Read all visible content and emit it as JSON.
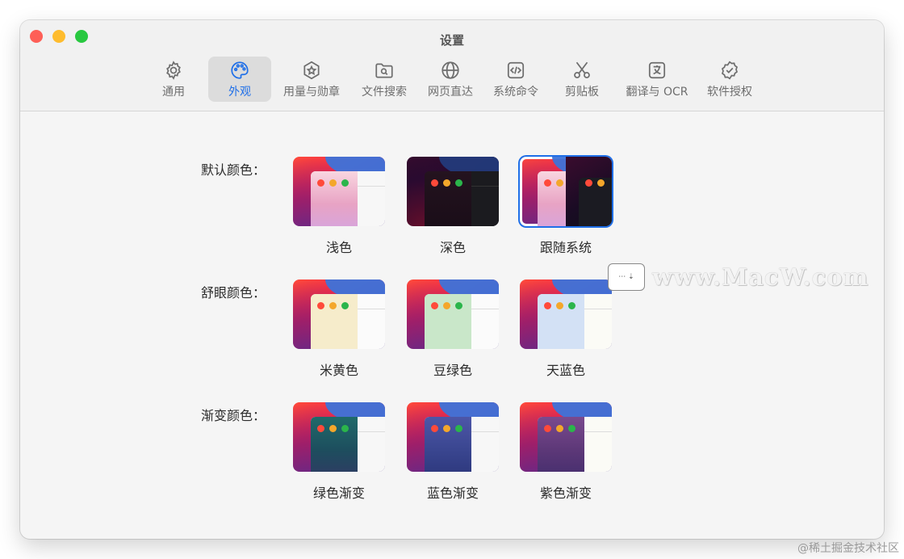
{
  "window": {
    "title": "设置"
  },
  "tabs": [
    {
      "label": "通用",
      "icon": "gear-icon"
    },
    {
      "label": "外观",
      "icon": "palette-icon",
      "active": true
    },
    {
      "label": "用量与勋章",
      "icon": "star-badge-icon"
    },
    {
      "label": "文件搜索",
      "icon": "folder-search-icon"
    },
    {
      "label": "网页直达",
      "icon": "globe-icon"
    },
    {
      "label": "系统命令",
      "icon": "code-icon"
    },
    {
      "label": "剪贴板",
      "icon": "scissors-icon"
    },
    {
      "label": "翻译与 OCR",
      "icon": "translate-icon"
    },
    {
      "label": "软件授权",
      "icon": "verified-badge-icon"
    }
  ],
  "theme_groups": [
    {
      "label": "默认颜色：",
      "options": [
        {
          "label": "浅色"
        },
        {
          "label": "深色"
        },
        {
          "label": "跟随系统",
          "selected": true
        }
      ]
    },
    {
      "label": "舒眼颜色：",
      "options": [
        {
          "label": "米黄色",
          "color": "#f6eccb"
        },
        {
          "label": "豆绿色",
          "color": "#c9e7c9"
        },
        {
          "label": "天蓝色",
          "color": "#d3e1f5"
        }
      ]
    },
    {
      "label": "渐变颜色：",
      "options": [
        {
          "label": "绿色渐变"
        },
        {
          "label": "蓝色渐变"
        },
        {
          "label": "紫色渐变"
        }
      ]
    }
  ],
  "watermark": {
    "text": "www.MacW.com"
  },
  "credit": "@稀土掘金技术社区",
  "colors": {
    "accent": "#1f6fe8"
  }
}
